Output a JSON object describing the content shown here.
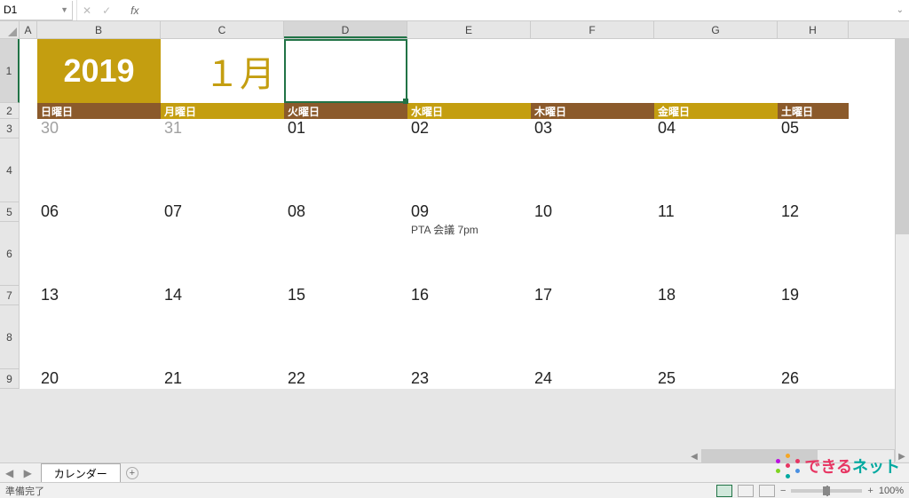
{
  "formula_bar": {
    "name_box_value": "D1",
    "cancel": "✕",
    "confirm": "✓",
    "fx_label": "fx",
    "formula_value": ""
  },
  "columns": [
    "A",
    "B",
    "C",
    "D",
    "E",
    "F",
    "G",
    "H"
  ],
  "active_col": "D",
  "active_row": "1",
  "rows": [
    "1",
    "2",
    "3",
    "4",
    "5",
    "6",
    "7",
    "8",
    "9"
  ],
  "calendar": {
    "year": "2019",
    "month": "１月",
    "days_of_week": [
      "日曜日",
      "月曜日",
      "火曜日",
      "水曜日",
      "木曜日",
      "金曜日",
      "土曜日"
    ],
    "dow_colors": [
      "brown",
      "gold",
      "brown",
      "gold",
      "brown",
      "gold",
      "brown"
    ],
    "weeks": [
      {
        "nums": [
          "30",
          "31",
          "01",
          "02",
          "03",
          "04",
          "05"
        ],
        "grey": [
          0,
          1
        ],
        "events_row": [
          "",
          "",
          "",
          "",
          "",
          "",
          ""
        ]
      },
      {
        "nums": [
          "06",
          "07",
          "08",
          "09",
          "10",
          "11",
          "12"
        ],
        "grey": [],
        "events_row": [
          "",
          "",
          "",
          "PTA 会議 7pm",
          "",
          "",
          ""
        ]
      },
      {
        "nums": [
          "13",
          "14",
          "15",
          "16",
          "17",
          "18",
          "19"
        ],
        "grey": [],
        "events_row": [
          "",
          "",
          "",
          "",
          "",
          "",
          ""
        ]
      },
      {
        "nums": [
          "20",
          "21",
          "22",
          "23",
          "24",
          "25",
          "26"
        ],
        "grey": [],
        "events_row": [
          "",
          "",
          "",
          "",
          "",
          "",
          ""
        ]
      }
    ]
  },
  "sheet": {
    "nav": "◀  ▶",
    "tab_name": "カレンダー",
    "add": "+"
  },
  "status": {
    "ready": "準備完了",
    "zoom_minus": "−",
    "zoom_plus": "+",
    "zoom_pct": "100%"
  },
  "brand": {
    "t1": "できる",
    "t2": "ネット"
  }
}
